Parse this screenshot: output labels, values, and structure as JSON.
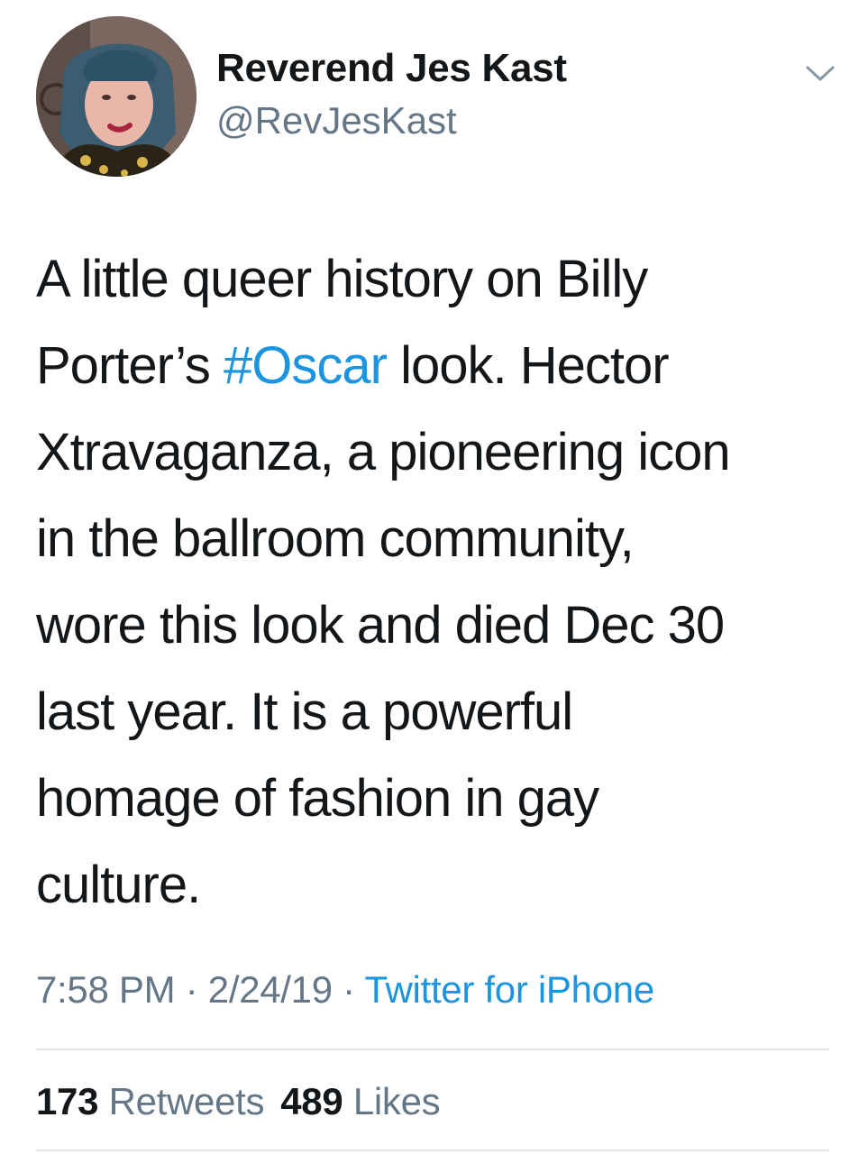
{
  "author": {
    "display_name": "Reverend Jes Kast",
    "handle": "@RevJesKast",
    "avatar_icon": "profile-photo"
  },
  "menu_icon": "chevron-down-icon",
  "tweet": {
    "lines": [
      [
        "A little queer history on Billy"
      ],
      [
        "Porter’s ",
        "#Oscar",
        " look. Hector"
      ],
      [
        "Xtravaganza, a pioneering icon"
      ],
      [
        "in the ballroom community,"
      ],
      [
        "wore this look and died Dec 30"
      ],
      [
        "last year. It is a powerful"
      ],
      [
        "homage of fashion in gay"
      ],
      [
        "culture."
      ]
    ],
    "hashtag": "#Oscar"
  },
  "meta": {
    "time": "7:58 PM",
    "sep1": " · ",
    "date": "2/24/19",
    "sep2": " · ",
    "source": "Twitter for iPhone"
  },
  "stats": {
    "retweets_count": "173",
    "retweets_label": "Retweets",
    "likes_count": "489",
    "likes_label": "Likes"
  },
  "colors": {
    "link": "#1b95e0",
    "secondary_text": "#657786",
    "primary_text": "#14171a",
    "divider": "#e1e8ed"
  }
}
